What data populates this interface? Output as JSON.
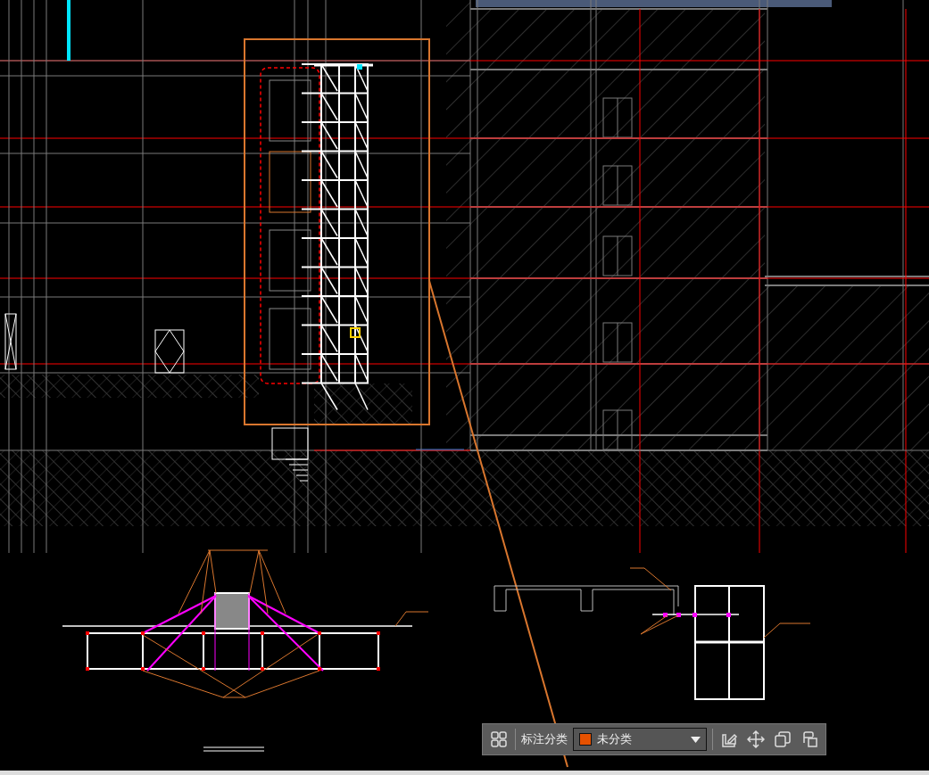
{
  "toolbar": {
    "label": "标注分类",
    "category": {
      "name": "未分类",
      "color": "#e65100"
    }
  }
}
